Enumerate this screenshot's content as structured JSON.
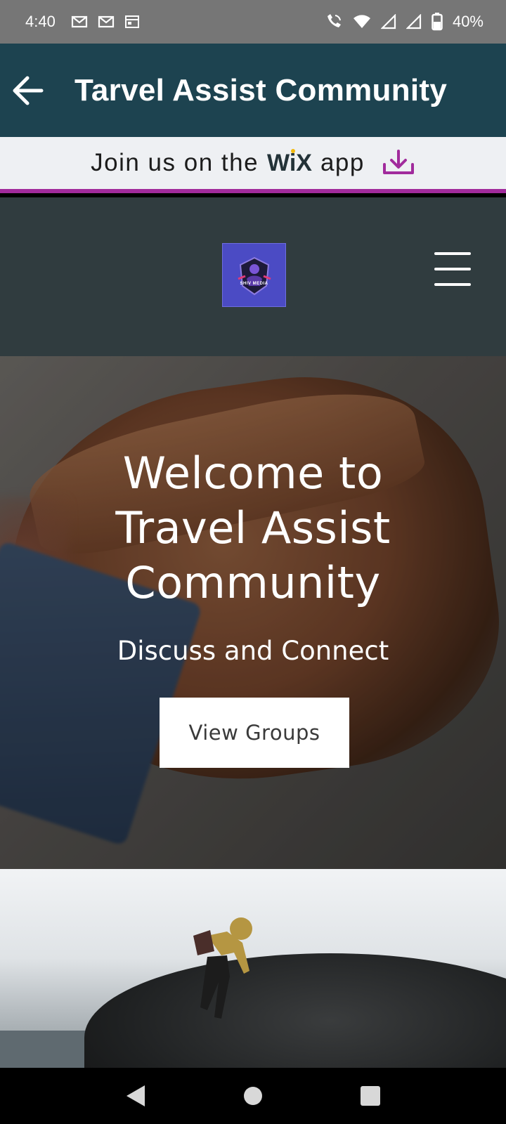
{
  "status_bar": {
    "time": "4:40",
    "battery": "40%",
    "icons": [
      "gmail-icon",
      "gmail-icon",
      "calendar-icon",
      "wifi-calling-icon",
      "wifi-icon",
      "signal-icon",
      "signal-icon",
      "battery-icon"
    ]
  },
  "app_bar": {
    "title": "Tarvel Assist Community",
    "back_icon": "arrow-back-icon",
    "color": "#1d4350"
  },
  "join_banner": {
    "text_before": "Join us on the",
    "brand": "WiX",
    "text_after": "app",
    "icon": "download-icon",
    "accent": "#a12b9c"
  },
  "site_header": {
    "logo_text": "SHIV MEDIA",
    "menu_icon": "hamburger-menu-icon"
  },
  "hero": {
    "title_lines": [
      "Welcome to",
      "Travel Assist",
      "Community"
    ],
    "subtitle": "Discuss and Connect",
    "button_label": "View Groups"
  },
  "nav_bar": {
    "buttons": [
      "back-nav-icon",
      "home-nav-icon",
      "recents-nav-icon"
    ]
  }
}
